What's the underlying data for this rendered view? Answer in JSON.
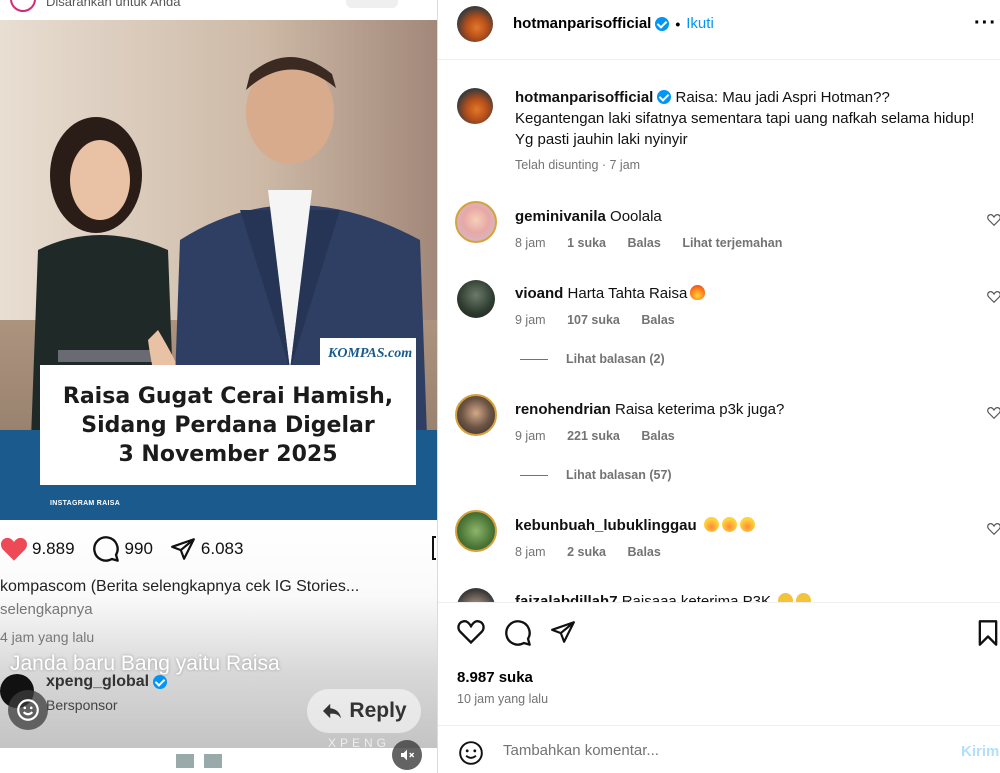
{
  "media": {
    "suggested_text": "Disarankan untuk Anda",
    "headline": "Raisa Gugat Cerai Hamish,\nSidang Perdana Digelar\n3 November 2025",
    "brand": "KOMPAS.com",
    "credit": "INSTAGRAM RAISA",
    "stats": {
      "likes": "9.889",
      "comments": "990",
      "shares": "6.083"
    },
    "caption_line": "kompascom (Berita selengkapnya cek IG Stories...",
    "more_link": "selengkapnya",
    "time_ago": "4 jam yang lalu",
    "overlay_comment": "Janda baru Bang yaitu Raisa",
    "sponsor_name": "xpeng_global",
    "sponsor_label": "Bersponsor",
    "reply_label": "Reply",
    "watermark": "XPENG"
  },
  "post": {
    "username": "hotmanparisofficial",
    "follow_label": "Ikuti",
    "more_glyph": "···",
    "caption": "Raisa: Mau jadi Aspri Hotman?? Kegantengan laki sifatnya sementara tapi uang nafkah selama hidup! Yg pasti jauhin laki nyinyir",
    "caption_meta": "Telah disunting · 7 jam",
    "comments": [
      {
        "user": "geminivanila",
        "text": "Ooolala",
        "time": "8 jam",
        "likes": "1 suka",
        "reply": "Balas",
        "translate": "Lihat terjemahan"
      },
      {
        "user": "vioand",
        "text": "Harta Tahta Raisa",
        "time": "9 jam",
        "likes": "107 suka",
        "reply": "Balas",
        "view_replies": "Lihat balasan (2)"
      },
      {
        "user": "renohendrian",
        "text": "Raisa keterima p3k juga?",
        "time": "9 jam",
        "likes": "221 suka",
        "reply": "Balas",
        "view_replies": "Lihat balasan (57)"
      },
      {
        "user": "kebunbuah_lubuklinggau",
        "text": "",
        "time": "8 jam",
        "likes": "2 suka",
        "reply": "Balas"
      },
      {
        "user": "faizalabdillah7",
        "text": "Raisaaa keterima P3K"
      }
    ],
    "likes_count": "8.987 suka",
    "time_ago": "10 jam yang lalu",
    "comment_placeholder": "Tambahkan komentar...",
    "send_label": "Kirim"
  },
  "colors": {
    "accent": "#0095f6",
    "like_red": "#ed4956",
    "muted": "#737373"
  },
  "icons": [
    "heart-icon",
    "comment-icon",
    "share-icon",
    "bookmark-icon",
    "emoji-icon",
    "verified-icon",
    "reply-arrow-icon",
    "mute-icon",
    "more-icon"
  ]
}
